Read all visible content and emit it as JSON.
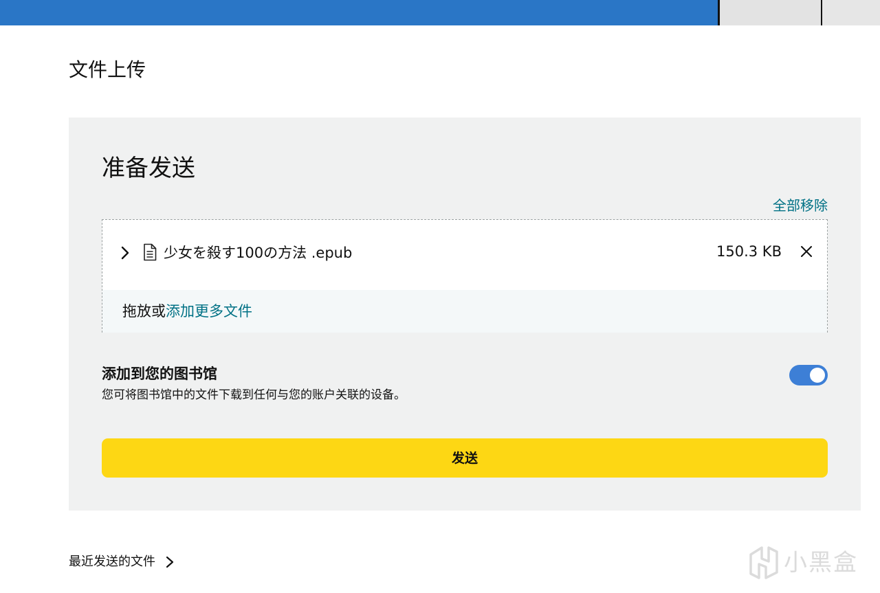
{
  "page": {
    "title": "文件上传"
  },
  "panel": {
    "title": "准备发送",
    "remove_all_label": "全部移除",
    "files": [
      {
        "name": "少女を殺す100の方法 .epub",
        "size": "150.3 KB"
      }
    ],
    "add_prefix": "拖放或",
    "add_link": "添加更多文件",
    "library": {
      "title": "添加到您的图书馆",
      "description": "您可将图书馆中的文件下载到任何与您的账户关联的设备。",
      "toggle_on": true
    },
    "send_label": "发送"
  },
  "footer": {
    "recent_label": "最近发送的文件"
  },
  "watermark": {
    "text": "小黑盒"
  },
  "colors": {
    "top_bar": "#2a76c6",
    "link": "#007185",
    "toggle": "#3d7fd6",
    "send_button": "#fdd714",
    "panel_bg": "#f0f1f1"
  }
}
